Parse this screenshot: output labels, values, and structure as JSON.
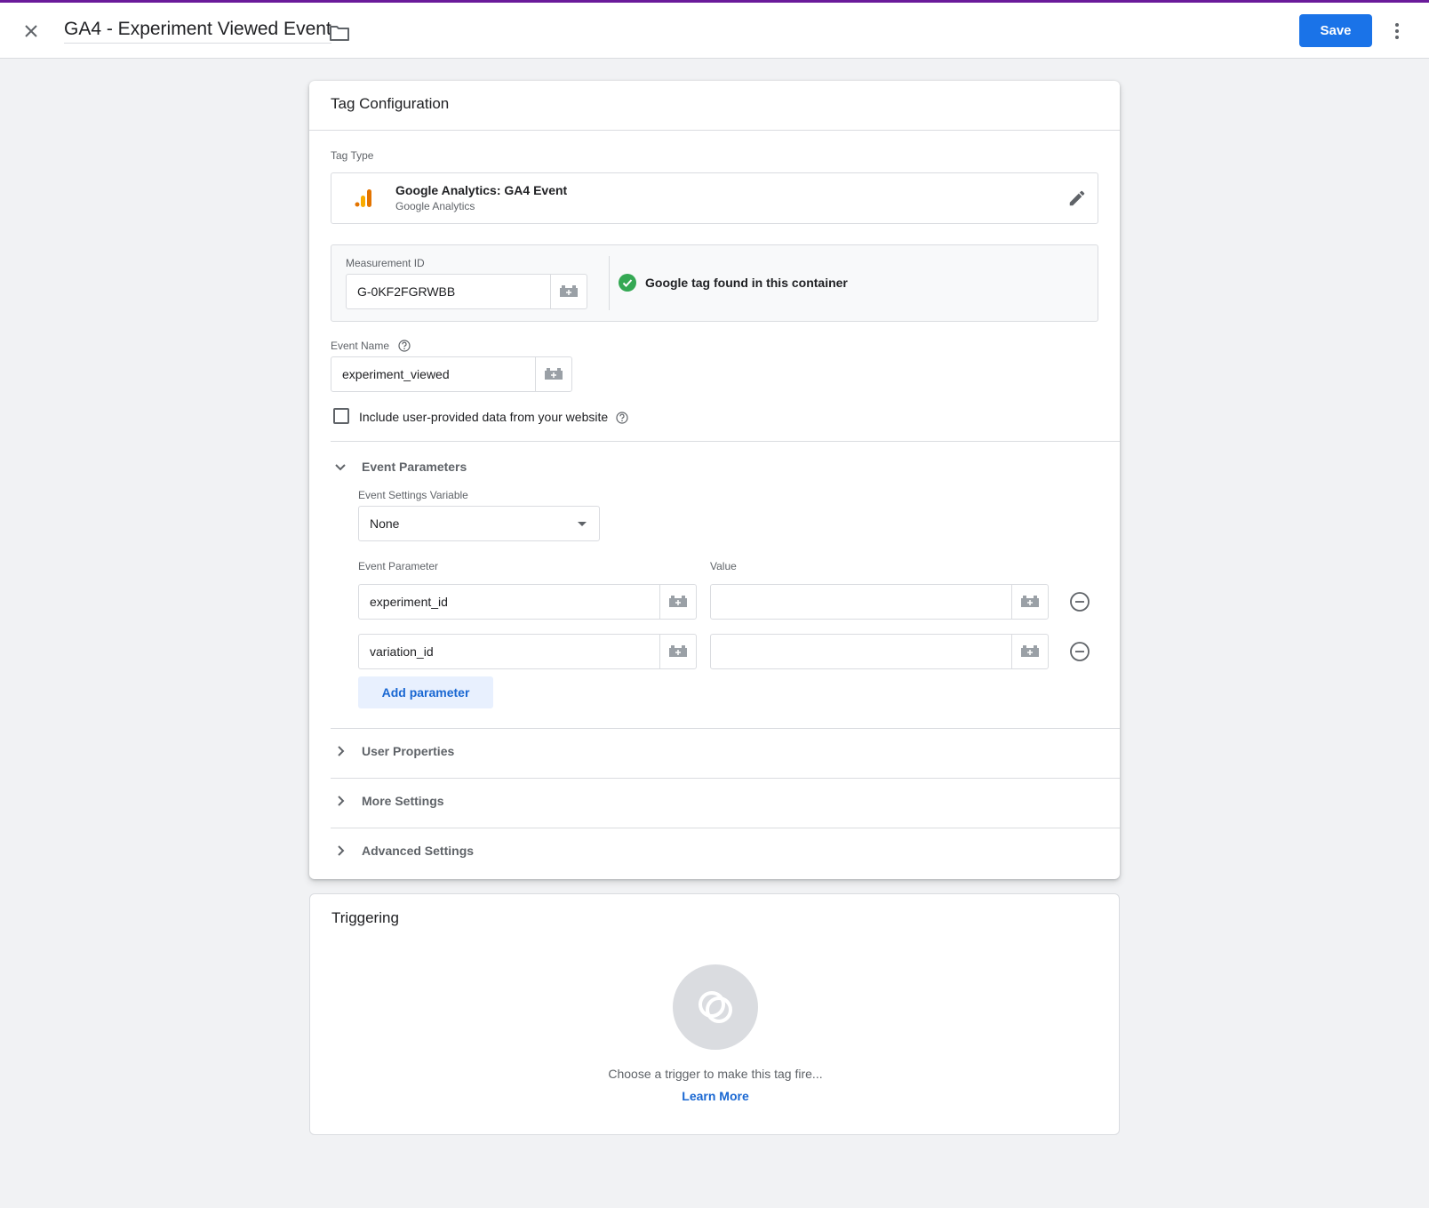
{
  "header": {
    "title": "GA4 - Experiment Viewed Event",
    "save_label": "Save",
    "close_icon": "close-icon",
    "folder_icon": "folder-icon",
    "more_icon": "more-vert-icon"
  },
  "tag_config": {
    "title": "Tag Configuration",
    "tag_type_label": "Tag Type",
    "tag_type": {
      "name": "Google Analytics: GA4 Event",
      "provider": "Google Analytics",
      "icon": "google-analytics-icon",
      "edit_icon": "pencil-icon"
    },
    "measurement_id": {
      "label": "Measurement ID",
      "value": "G-0KF2FGRWBB",
      "status": "Google tag found in this container",
      "status_icon": "check-circle-icon"
    },
    "event_name": {
      "label": "Event Name",
      "value": "experiment_viewed",
      "help_icon": "help-icon"
    },
    "user_data": {
      "label": "Include user-provided data from your website",
      "checked": false
    },
    "event_parameters": {
      "title": "Event Parameters",
      "expanded": true,
      "settings_variable_label": "Event Settings Variable",
      "settings_variable_value": "None",
      "param_col_label": "Event Parameter",
      "value_col_label": "Value",
      "rows": [
        {
          "name": "experiment_id",
          "value": ""
        },
        {
          "name": "variation_id",
          "value": ""
        }
      ],
      "add_label": "Add parameter"
    },
    "sections": [
      {
        "title": "User Properties"
      },
      {
        "title": "More Settings"
      },
      {
        "title": "Advanced Settings"
      }
    ]
  },
  "triggering": {
    "title": "Triggering",
    "prompt": "Choose a trigger to make this tag fire...",
    "learn_more": "Learn More",
    "icon": "trigger-icon"
  },
  "colors": {
    "accent": "#1a73e8",
    "top_line": "#6a1b9a",
    "success": "#34a853",
    "ga_orange": "#f9ab00",
    "ga_dark_orange": "#e37400"
  }
}
